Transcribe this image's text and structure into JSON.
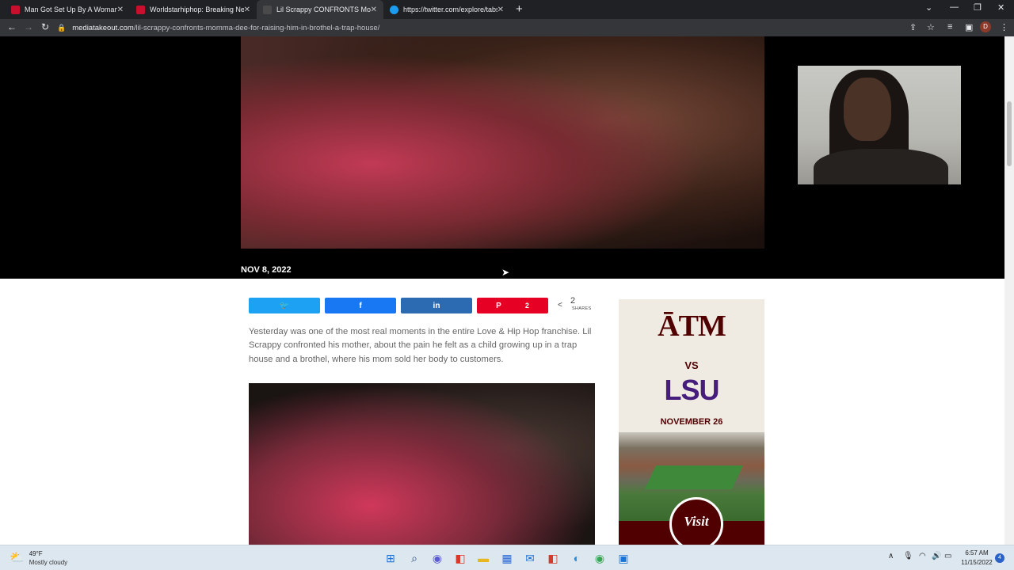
{
  "browser": {
    "tabs": [
      {
        "title": "Man Got Set Up By A Woman On",
        "favicon_color": "#c8102e",
        "active": false
      },
      {
        "title": "Worldstarhiphop: Breaking News",
        "favicon_color": "#c8102e",
        "active": false
      },
      {
        "title": "Lil Scrappy CONFRONTS Momma",
        "favicon_color": "#4a4a4a",
        "active": true
      },
      {
        "title": "https://twitter.com/explore/tabs",
        "favicon_color": "#1d9bf0",
        "active": false
      }
    ],
    "url_host": "mediatakeout.com",
    "url_path": "/lil-scrappy-confronts-momma-dee-for-raising-him-in-brothel-a-trap-house/",
    "profile_initial": "D"
  },
  "article": {
    "date": "NOV 8, 2022",
    "body": "Yesterday was one of the most real moments in the entire Love & Hip Hop franchise. Lil Scrappy confronted his mother, about the pain he felt as a child growing up in a trap house and a brothel, where his mom sold her body to customers."
  },
  "share_bar": {
    "buttons": [
      {
        "network": "twitter",
        "icon": "twitter-icon",
        "glyph": "🐦",
        "color": "#1da1f2",
        "count": ""
      },
      {
        "network": "facebook",
        "icon": "facebook-icon",
        "glyph": "f",
        "color": "#1877f2",
        "count": ""
      },
      {
        "network": "linkedin",
        "icon": "linkedin-icon",
        "glyph": "in",
        "color": "#2c6ab1",
        "count": ""
      },
      {
        "network": "pinterest",
        "icon": "pinterest-icon",
        "glyph": "P",
        "color": "#e60023",
        "count": "2"
      }
    ],
    "total": "2",
    "total_label": "SHARES"
  },
  "ad": {
    "team1": "ĀTM",
    "vs": "VS",
    "team2": "LSU",
    "date": "NOVEMBER 26",
    "seal": "Visit",
    "colors": {
      "maroon": "#500000",
      "purple": "#461d7c"
    }
  },
  "taskbar": {
    "temp": "49°F",
    "condition": "Mostly cloudy",
    "time": "6:57 AM",
    "date": "11/15/2022",
    "notifications": "4"
  }
}
